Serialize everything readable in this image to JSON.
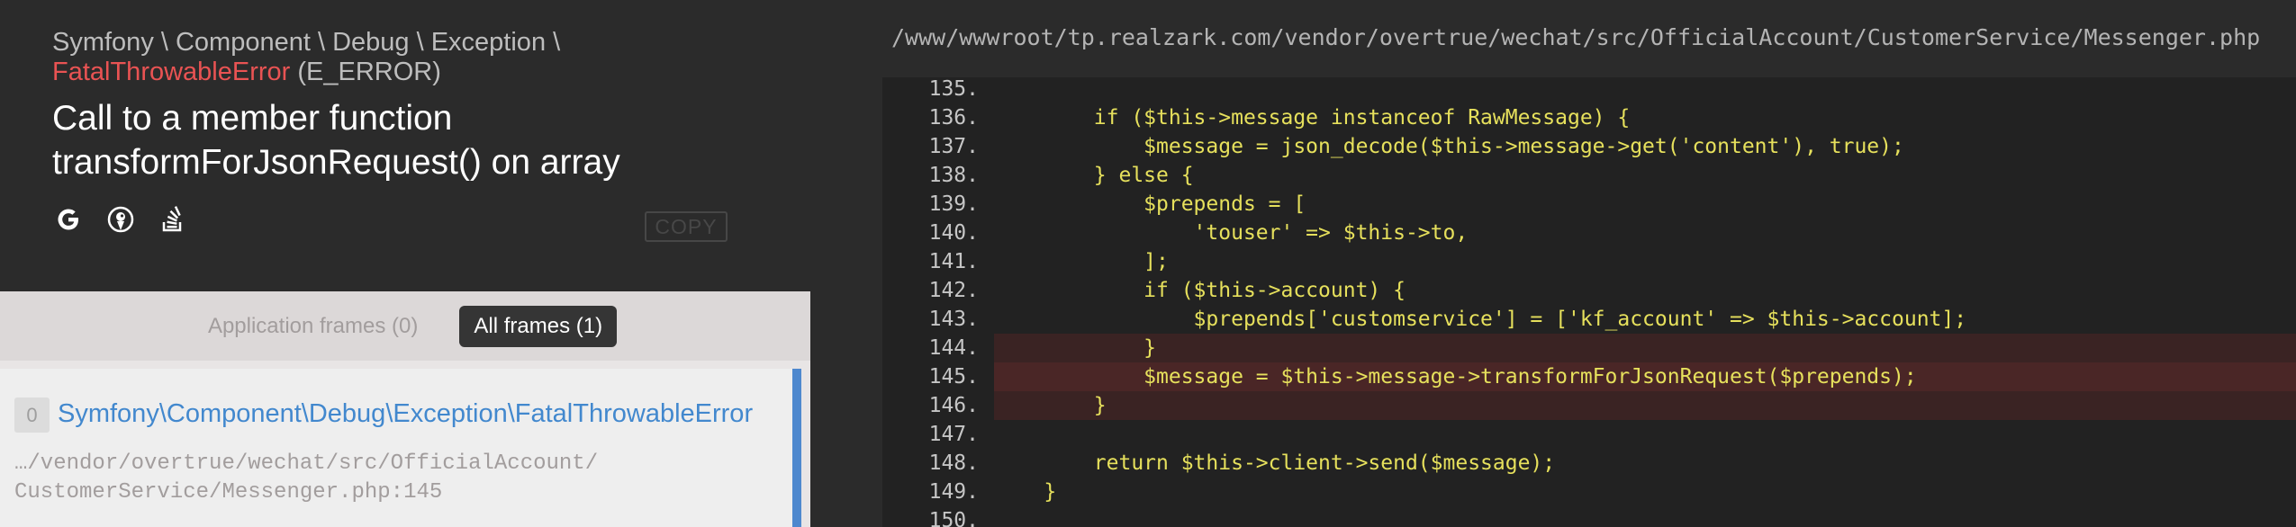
{
  "exception": {
    "namespace": "Symfony \\ Component \\ Debug \\ Exception \\",
    "class_name": "FatalThrowableError",
    "type": " (E_ERROR)",
    "message": "Call to a member function transformForJsonRequest() on array"
  },
  "icons": [
    "google-icon",
    "duckduckgo-icon",
    "stackoverflow-icon"
  ],
  "copy_label": "COPY",
  "tabs": {
    "application": "Application frames (0)",
    "all": "All frames (1)"
  },
  "frame": {
    "index": "0",
    "class": "Symfony\\Component\\Debug\\Exception\\FatalThrowableError",
    "file_line1": "…/vendor/overtrue/wechat/src/OfficialAccount/",
    "file_line2": "CustomerService/Messenger.php:145"
  },
  "code": {
    "file_path": "/www/wwwroot/tp.realzark.com/vendor/overtrue/wechat/src/OfficialAccount/CustomerService/Messenger.php",
    "highlight_line": "145.",
    "lines": [
      {
        "num": "135.",
        "text": ""
      },
      {
        "num": "136.",
        "text": "        if ($this->message instanceof RawMessage) {"
      },
      {
        "num": "137.",
        "text": "            $message = json_decode($this->message->get('content'), true);"
      },
      {
        "num": "138.",
        "text": "        } else {"
      },
      {
        "num": "139.",
        "text": "            $prepends = ["
      },
      {
        "num": "140.",
        "text": "                'touser' => $this->to,"
      },
      {
        "num": "141.",
        "text": "            ];"
      },
      {
        "num": "142.",
        "text": "            if ($this->account) {"
      },
      {
        "num": "143.",
        "text": "                $prepends['customservice'] = ['kf_account' => $this->account];"
      },
      {
        "num": "144.",
        "text": "            }"
      },
      {
        "num": "145.",
        "text": "            $message = $this->message->transformForJsonRequest($prepends);"
      },
      {
        "num": "146.",
        "text": "        }"
      },
      {
        "num": "147.",
        "text": ""
      },
      {
        "num": "148.",
        "text": "        return $this->client->send($message);"
      },
      {
        "num": "149.",
        "text": "    }"
      },
      {
        "num": "150.",
        "text": ""
      }
    ]
  },
  "colors": {
    "background": "#2b2b2b",
    "exception_class": "#e95353",
    "frame_link": "#4288ce",
    "frame_accent": "#4e88ce",
    "code_text": "#e6e05c",
    "highlight": "#4a2626"
  }
}
